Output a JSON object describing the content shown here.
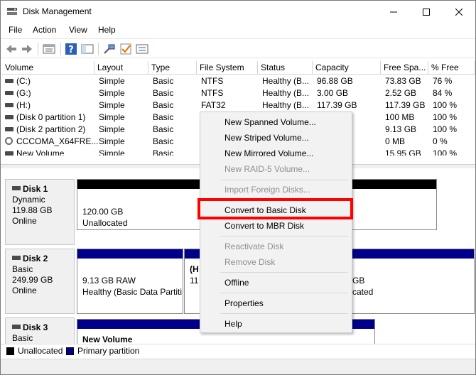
{
  "window": {
    "title": "Disk Management"
  },
  "menu": {
    "items": [
      "File",
      "Action",
      "View",
      "Help"
    ]
  },
  "toolbar": {
    "icons": [
      "back-arrow-icon",
      "forward-arrow-icon",
      "properties-icon",
      "help-icon",
      "console-tree-icon",
      "connect-icon",
      "check-icon",
      "settings-list-icon"
    ]
  },
  "volume_list": {
    "columns": [
      "Volume",
      "Layout",
      "Type",
      "File System",
      "Status",
      "Capacity",
      "Free Spa...",
      "% Free"
    ],
    "rows": [
      {
        "volume": "(C:)",
        "layout": "Simple",
        "type": "Basic",
        "fs": "NTFS",
        "status": "Healthy (B...",
        "capacity": "96.88 GB",
        "free": "73.83 GB",
        "pct": "76 %",
        "icon": "volume-icon"
      },
      {
        "volume": "(G:)",
        "layout": "Simple",
        "type": "Basic",
        "fs": "NTFS",
        "status": "Healthy (B...",
        "capacity": "3.00 GB",
        "free": "2.52 GB",
        "pct": "84 %",
        "icon": "volume-icon"
      },
      {
        "volume": "(H:)",
        "layout": "Simple",
        "type": "Basic",
        "fs": "FAT32",
        "status": "Healthy (B...",
        "capacity": "117.39 GB",
        "free": "117.39 GB",
        "pct": "100 %",
        "icon": "volume-icon"
      },
      {
        "volume": "(Disk 0 partition 1)",
        "layout": "Simple",
        "type": "Basic",
        "fs": "",
        "status": "",
        "capacity": "",
        "free": "100 MB",
        "pct": "100 %",
        "icon": "volume-icon"
      },
      {
        "volume": "(Disk 2 partition 2)",
        "layout": "Simple",
        "type": "Basic",
        "fs": "",
        "status": "",
        "capacity": "",
        "free": "9.13 GB",
        "pct": "100 %",
        "icon": "volume-icon"
      },
      {
        "volume": "CCCOMA_X64FRE...",
        "layout": "Simple",
        "type": "Basic",
        "fs": "",
        "status": "",
        "capacity": "",
        "free": "0 MB",
        "pct": "0 %",
        "icon": "cd-drive-icon"
      },
      {
        "volume": "New Volume",
        "layout": "Simple",
        "type": "Basic",
        "fs": "",
        "status": "",
        "capacity": "",
        "free": "15.95 GB",
        "pct": "100 %",
        "icon": "volume-icon"
      }
    ]
  },
  "disks": [
    {
      "name": "Disk 1",
      "type": "Dynamic",
      "size": "119.88 GB",
      "state": "Online",
      "partitions": [
        {
          "size": "120.00 GB",
          "desc": "Unallocated"
        }
      ]
    },
    {
      "name": "Disk 2",
      "type": "Basic",
      "size": "249.99 GB",
      "state": "Online",
      "partitions": [
        {
          "size": "9.13 GB RAW",
          "desc": "Healthy (Basic Data Partiti"
        },
        {
          "title": "(H",
          "size": "11",
          "desc": ""
        },
        {
          "size": "GB",
          "desc": "cated"
        }
      ]
    },
    {
      "name": "Disk 3",
      "type": "Basic",
      "size": "",
      "state": "",
      "partitions": [
        {
          "title": "New Volume"
        }
      ]
    }
  ],
  "legend": {
    "unallocated": "Unallocated",
    "primary": "Primary partition",
    "unallocated_color": "#000000",
    "primary_color": "#00008b"
  },
  "context_menu": {
    "items": [
      {
        "label": "New Spanned Volume...",
        "enabled": true
      },
      {
        "label": "New Striped Volume...",
        "enabled": true
      },
      {
        "label": "New Mirrored Volume...",
        "enabled": true
      },
      {
        "label": "New RAID-5 Volume...",
        "enabled": false
      },
      {
        "label": "Import Foreign Disks...",
        "enabled": false
      },
      {
        "label": "Convert to Basic Disk",
        "enabled": true
      },
      {
        "label": "Convert to MBR Disk",
        "enabled": true
      },
      {
        "label": "Reactivate Disk",
        "enabled": false
      },
      {
        "label": "Remove Disk",
        "enabled": false
      },
      {
        "label": "Offline",
        "enabled": true
      },
      {
        "label": "Properties",
        "enabled": true
      },
      {
        "label": "Help",
        "enabled": true
      }
    ],
    "highlight_color": "#ff0000"
  }
}
